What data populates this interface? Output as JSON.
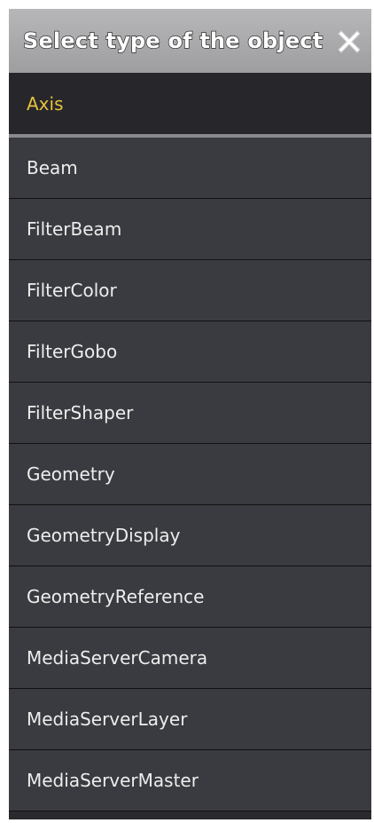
{
  "dialog": {
    "title": "Select type of the object",
    "close_icon": "close-x-icon"
  },
  "list": {
    "selected_index": 0,
    "items": [
      {
        "label": "Axis"
      },
      {
        "label": "Beam"
      },
      {
        "label": "FilterBeam"
      },
      {
        "label": "FilterColor"
      },
      {
        "label": "FilterGobo"
      },
      {
        "label": "FilterShaper"
      },
      {
        "label": "Geometry"
      },
      {
        "label": "GeometryDisplay"
      },
      {
        "label": "GeometryReference"
      },
      {
        "label": "MediaServerCamera"
      },
      {
        "label": "MediaServerLayer"
      },
      {
        "label": "MediaServerMaster"
      }
    ]
  },
  "colors": {
    "selected_text": "#e6c23c",
    "item_text": "#ededed",
    "item_bg": "#3a3b40",
    "selected_bg": "#27272b",
    "titlebar_bg": "#a9a9ac"
  }
}
